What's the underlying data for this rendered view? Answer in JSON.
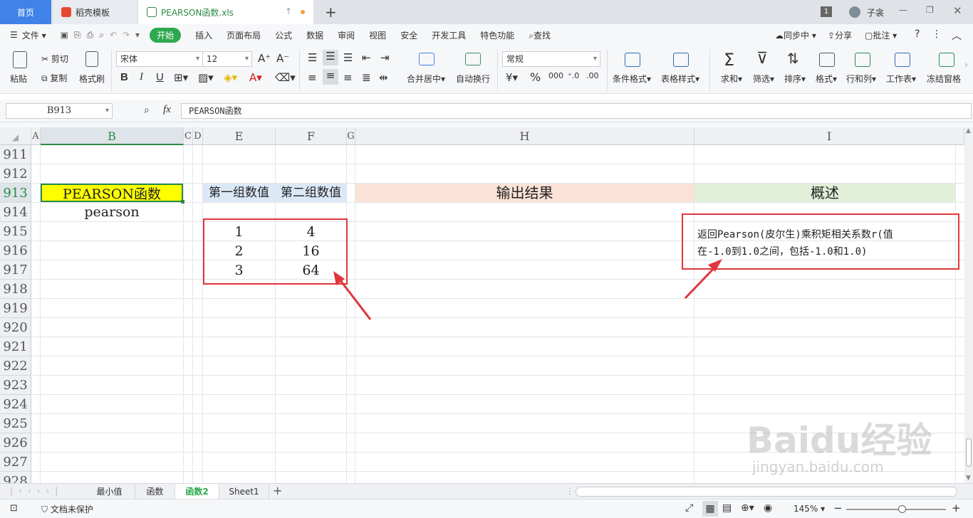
{
  "titlebar": {
    "tabs": [
      {
        "label": "首页"
      },
      {
        "label": "稻壳模板"
      },
      {
        "label": "PEARSON函数.xls"
      }
    ],
    "new_tab": "+",
    "badge": "1",
    "user": "子衾"
  },
  "menubar": {
    "file": "文件",
    "items": [
      "开始",
      "插入",
      "页面布局",
      "公式",
      "数据",
      "审阅",
      "视图",
      "安全",
      "开发工具",
      "特色功能"
    ],
    "search": "查找",
    "sync": "同步中",
    "share": "分享",
    "comment": "批注"
  },
  "ribbon": {
    "paste": "粘贴",
    "cut": "剪切",
    "copy": "复制",
    "format_painter": "格式刷",
    "font_name": "宋体",
    "font_size": "12",
    "bold": "B",
    "italic": "I",
    "underline": "U",
    "merge_center": "合并居中",
    "wrap_text": "自动换行",
    "number_format": "常规",
    "percent": "%",
    "conditional_format": "条件格式",
    "table_style": "表格样式",
    "sum": "求和",
    "filter": "筛选",
    "sort": "排序",
    "format": "格式",
    "row_col": "行和列",
    "worksheet": "工作表",
    "freeze": "冻结窗格"
  },
  "formula_bar": {
    "name_box": "B913",
    "fx": "fx",
    "formula": "PEARSON函数"
  },
  "columns": [
    "A",
    "B",
    "C",
    "D",
    "E",
    "F",
    "G",
    "H",
    "I"
  ],
  "rows": [
    "911",
    "912",
    "913",
    "914",
    "915",
    "916",
    "917",
    "918",
    "919",
    "920",
    "921",
    "922",
    "923",
    "924",
    "925",
    "926",
    "927",
    "928"
  ],
  "cells": {
    "b913": "PEARSON函数",
    "b914": "pearson",
    "e913": "第一组数值",
    "f913": "第二组数值",
    "h913": "输出结果",
    "i913": "概述",
    "e915": "1",
    "f915": "4",
    "e916": "2",
    "f916": "16",
    "e917": "3",
    "f917": "64",
    "i915_line1": "返回Pearson(皮尔生)乘积矩相关系数r(值",
    "i915_line2": "在-1.0到1.0之间，包括-1.0和1.0)"
  },
  "sheet_tabs": [
    "最小值",
    "函数",
    "函数2",
    "Sheet1"
  ],
  "active_sheet": "函数2",
  "statusbar": {
    "protect": "文档未保护",
    "zoom": "145%"
  },
  "watermark": "Baidu经验 jingyan.baidu.com",
  "colors": {
    "accent": "#2ea94e",
    "home_tab": "#3f83e8",
    "annotation_red": "#e0363d",
    "header_yellow": "#ffff00",
    "header_blue": "#dbe9f7",
    "header_peach": "#fbe2d6",
    "header_green": "#e2efd9"
  }
}
